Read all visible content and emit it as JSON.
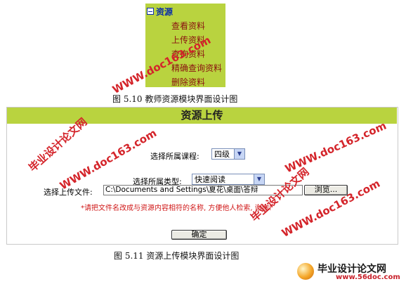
{
  "fig510": {
    "menu": {
      "header": "资源",
      "items": [
        "查看资料",
        "上传资料",
        "查询资料",
        "精确查询资料",
        "删除资料"
      ]
    },
    "caption": "图 5.10  教师资源模块界面设计图"
  },
  "fig511": {
    "title": "资源上传",
    "course_label": "选择所属课程:",
    "course_value": "四级",
    "type_label": "选择所属类型:",
    "type_value": "快速阅读",
    "file_label": "选择上传文件:",
    "file_value": "C:\\Documents and Settings\\夏花\\桌面\\答辩",
    "browse_label": "浏览...",
    "notice": "*请把文件名改成与资源内容相符的名称, 方便他人检索, 谢谢!",
    "confirm_label": "确定",
    "caption": "图 5.11  资源上传模块界面设计图"
  },
  "watermark": {
    "brand": "毕业设计论文网",
    "site": "WWW.doc163.com",
    "logo_text": "毕业设计论文网",
    "logo_url": "www.56doc.com"
  },
  "colors": {
    "panel_green": "#b9d33f",
    "link_red": "#8a1010",
    "notice_red": "#d01818",
    "watermark_red": "#d4242a"
  }
}
